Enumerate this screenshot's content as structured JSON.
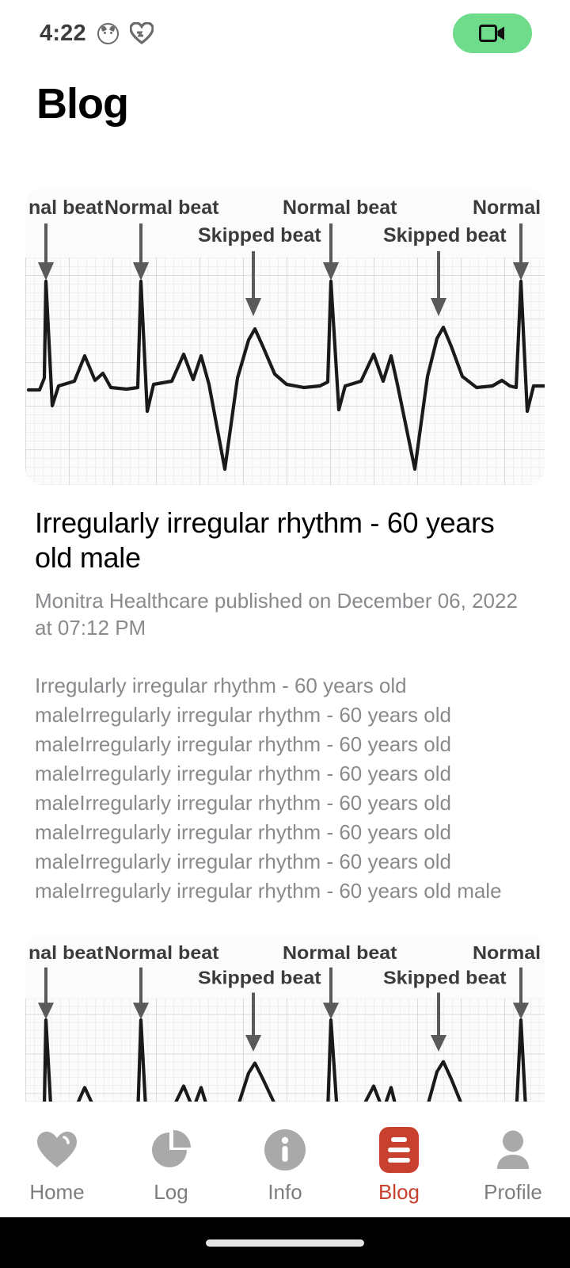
{
  "status_bar": {
    "time": "4:22",
    "icons": [
      "cat-face-icon",
      "heart-icon"
    ],
    "action_button": {
      "icon": "video-camera-icon",
      "color": "#6fdc8c"
    }
  },
  "header": {
    "title": "Blog"
  },
  "posts": [
    {
      "image": {
        "alt": "ecg-rhythm-strip",
        "labels": [
          "nal beat",
          "Normal beat",
          "Skipped beat",
          "Normal beat",
          "Skipped beat",
          "Normal"
        ]
      },
      "title": "Irregularly irregular rhythm - 60 years old male",
      "byline": "Monitra Healthcare published on December 06, 2022 at 07:12 PM",
      "body": "Irregularly irregular rhythm - 60 years old maleIrregularly irregular rhythm - 60 years old maleIrregularly irregular rhythm - 60 years old maleIrregularly irregular rhythm - 60 years old maleIrregularly irregular rhythm - 60 years old maleIrregularly irregular rhythm - 60 years old maleIrregularly irregular rhythm - 60 years old maleIrregularly irregular rhythm - 60 years old male"
    },
    {
      "image": {
        "alt": "ecg-rhythm-strip",
        "labels": [
          "nal beat",
          "Normal beat",
          "Skipped beat",
          "Normal beat",
          "Skipped beat",
          "Normal"
        ]
      }
    }
  ],
  "bottom_nav": {
    "active": "Blog",
    "items": [
      {
        "label": "Home",
        "icon": "heart-icon"
      },
      {
        "label": "Log",
        "icon": "pie-chart-icon"
      },
      {
        "label": "Info",
        "icon": "info-circle-icon"
      },
      {
        "label": "Blog",
        "icon": "document-lines-icon"
      },
      {
        "label": "Profile",
        "icon": "person-icon"
      }
    ],
    "inactive_color": "#a9a9a9",
    "active_color": "#c8412f"
  }
}
